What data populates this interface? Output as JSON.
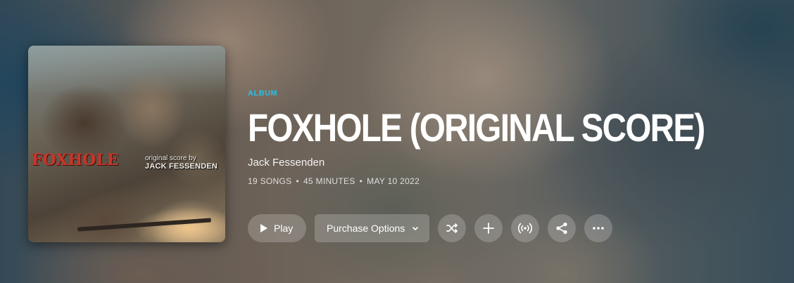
{
  "album": {
    "type_label": "ALBUM",
    "title": "FOXHOLE (ORIGINAL SCORE)",
    "artist": "Jack Fessenden",
    "songs": "19 SONGS",
    "duration": "45 MINUTES",
    "release_date": "MAY 10 2022",
    "separator": "•"
  },
  "cover": {
    "title_text": "FOXHOLE",
    "credit_line1": "original score by",
    "credit_line2": "JACK FESSENDEN"
  },
  "actions": {
    "play_label": "Play",
    "purchase_label": "Purchase Options",
    "shuffle_icon": "shuffle-icon",
    "add_icon": "plus-icon",
    "broadcast_icon": "broadcast-icon",
    "share_icon": "share-icon",
    "more_icon": "more-icon"
  },
  "colors": {
    "accent": "#25c0e6",
    "cover_title": "#c8352a"
  }
}
